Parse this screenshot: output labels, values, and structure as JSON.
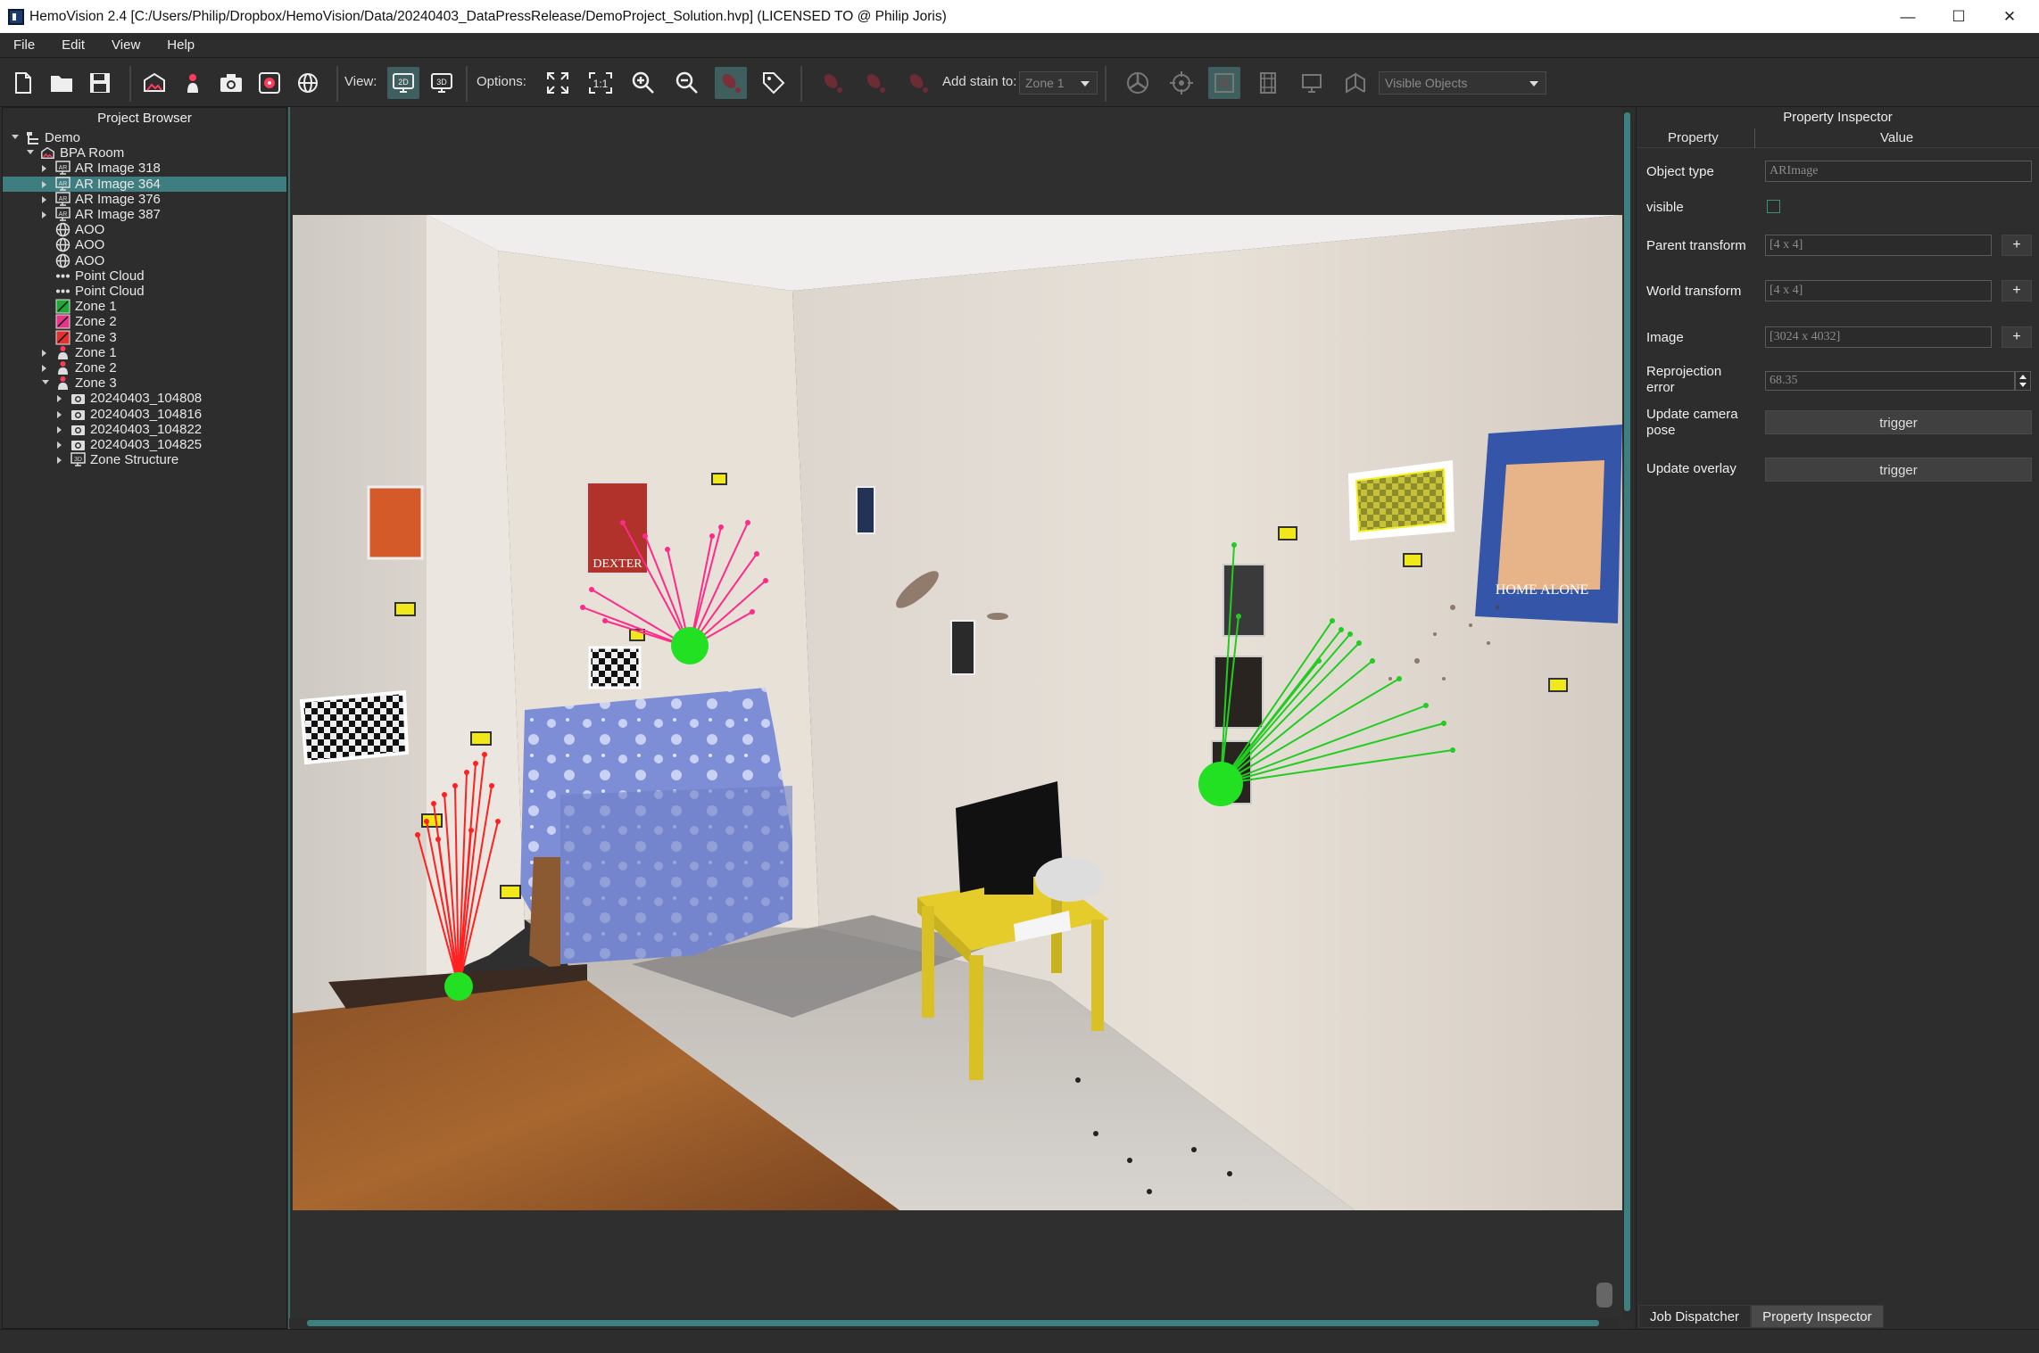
{
  "window": {
    "title": "HemoVision 2.4 [C:/Users/Philip/Dropbox/HemoVision/Data/20240403_DataPressRelease/DemoProject_Solution.hvp] (LICENSED TO @ Philip Joris)",
    "minimize": "—",
    "maximize": "☐",
    "close": "✕"
  },
  "menu": [
    "File",
    "Edit",
    "View",
    "Help"
  ],
  "toolbar": {
    "view_label": "View:",
    "view_2d": "2D",
    "view_3d": "3D",
    "options_label": "Options:",
    "one_to_one": "1:1",
    "add_stain_label": "Add stain to:",
    "add_stain_value": "Zone 1",
    "visible_objects_value": "Visible Objects"
  },
  "browser": {
    "title": "Project Browser",
    "items": [
      {
        "label": "Demo",
        "icon": "project-icon",
        "expanded": true
      },
      {
        "label": "BPA Room",
        "icon": "room-icon",
        "expanded": true
      },
      {
        "label": "AR Image 318",
        "icon": "ar-image-icon",
        "expanded": false
      },
      {
        "label": "AR Image 364",
        "icon": "ar-image-icon",
        "expanded": false,
        "selected": true
      },
      {
        "label": "AR Image 376",
        "icon": "ar-image-icon",
        "expanded": false
      },
      {
        "label": "AR Image 387",
        "icon": "ar-image-icon",
        "expanded": false
      },
      {
        "label": "AOO",
        "icon": "globe-icon"
      },
      {
        "label": "AOO",
        "icon": "globe-icon"
      },
      {
        "label": "AOO",
        "icon": "globe-icon"
      },
      {
        "label": "Point Cloud",
        "icon": "point-cloud-icon"
      },
      {
        "label": "Point Cloud",
        "icon": "point-cloud-icon"
      },
      {
        "label": "Zone 1",
        "icon": "zone-green-icon",
        "color": "#1fa834"
      },
      {
        "label": "Zone 2",
        "icon": "zone-pink-icon",
        "color": "#e8338a"
      },
      {
        "label": "Zone 3",
        "icon": "zone-red-icon",
        "color": "#e53030"
      },
      {
        "label": "Zone 1",
        "icon": "stain-zone-icon",
        "expanded": false
      },
      {
        "label": "Zone 2",
        "icon": "stain-zone-icon",
        "expanded": false
      },
      {
        "label": "Zone 3",
        "icon": "stain-zone-icon",
        "expanded": true
      },
      {
        "label": "20240403_104808",
        "icon": "camera-icon",
        "expanded": false
      },
      {
        "label": "20240403_104816",
        "icon": "camera-icon",
        "expanded": false
      },
      {
        "label": "20240403_104822",
        "icon": "camera-icon",
        "expanded": false
      },
      {
        "label": "20240403_104825",
        "icon": "camera-icon",
        "expanded": false
      },
      {
        "label": "Zone Structure",
        "icon": "3d-structure-icon",
        "expanded": false
      }
    ]
  },
  "inspector": {
    "title": "Property Inspector",
    "col_property": "Property",
    "col_value": "Value",
    "object_type_label": "Object type",
    "object_type_value": "ARImage",
    "visible_label": "visible",
    "visible_checked": false,
    "parent_transform_label": "Parent transform",
    "parent_transform_value": "[4 x 4]",
    "world_transform_label": "World transform",
    "world_transform_value": "[4 x 4]",
    "image_label": "Image",
    "image_value": "[3024 x 4032]",
    "reprojection_label_1": "Reprojection",
    "reprojection_label_2": "error",
    "reprojection_value": "68.35",
    "update_camera_label_1": "Update camera",
    "update_camera_label_2": "pose",
    "update_camera_button": "trigger",
    "update_overlay_label": "Update overlay",
    "update_overlay_button": "trigger",
    "plus": "+"
  },
  "bottom_tabs": [
    "Job Dispatcher",
    "Property Inspector"
  ],
  "photo_overlay": {
    "pink_label": "DEXTER",
    "poster_right": "HOME ALONE"
  },
  "colors": {
    "accent": "#3f7e80",
    "zone_green": "#22dd22",
    "zone_pink": "#ff2a8a",
    "zone_red": "#ff2020"
  }
}
